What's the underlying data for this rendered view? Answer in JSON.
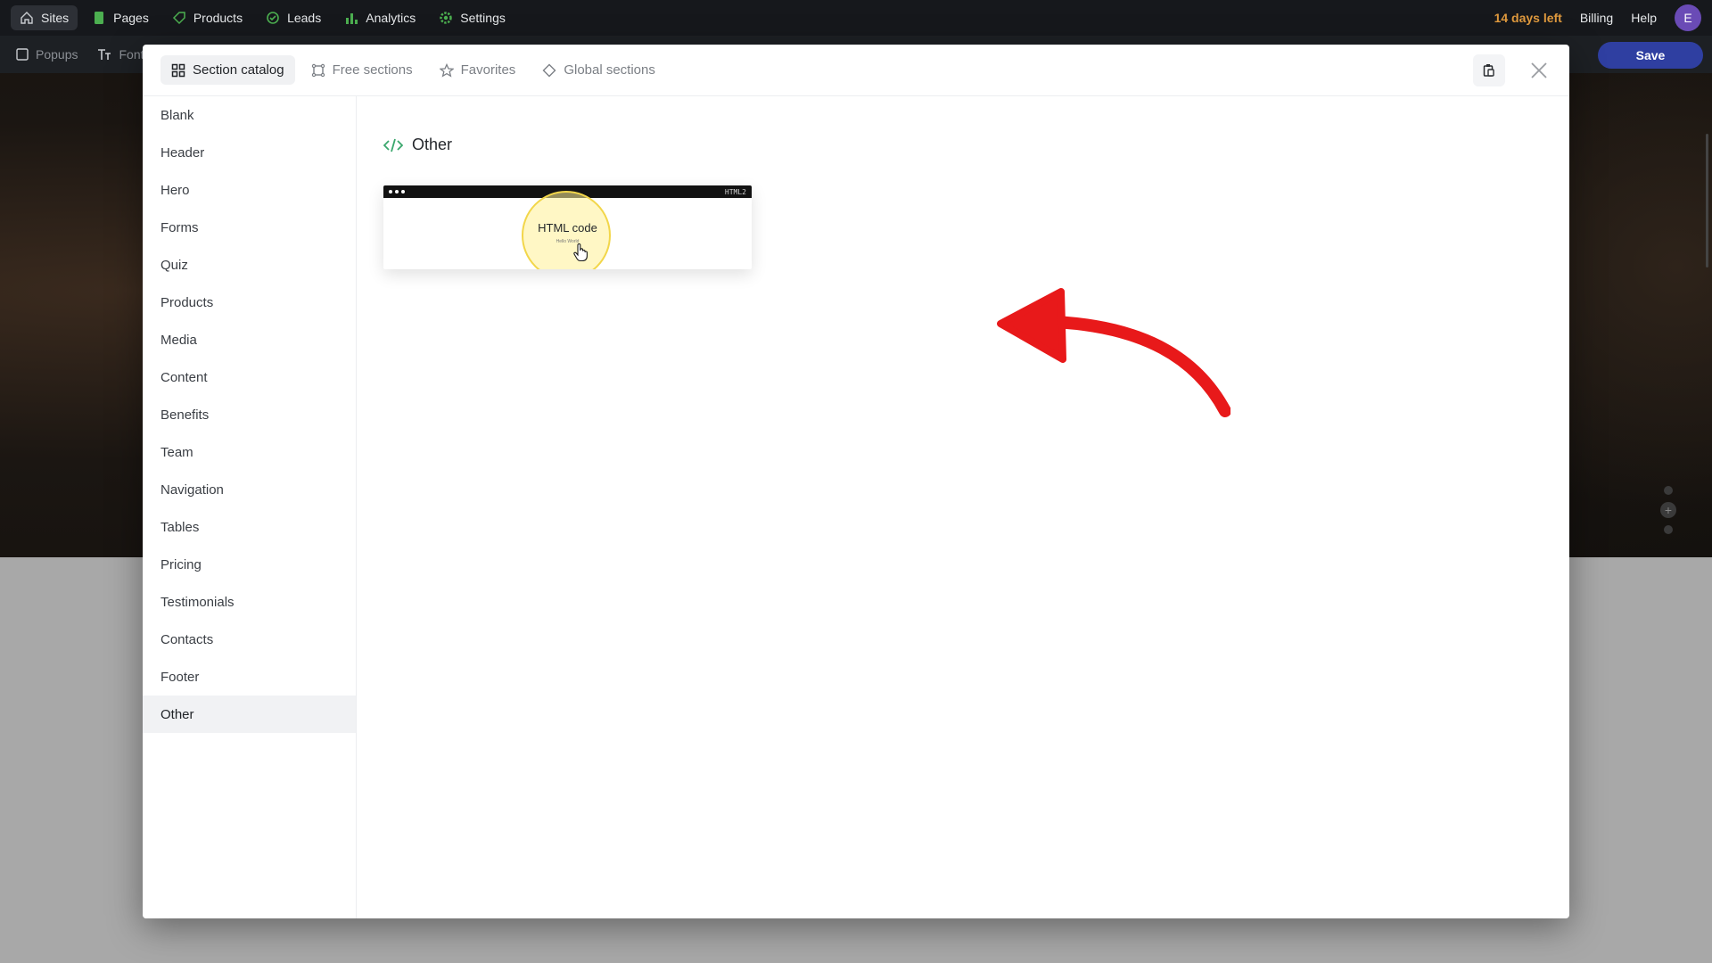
{
  "topbar": {
    "items": [
      {
        "label": "Sites",
        "icon": "home-icon"
      },
      {
        "label": "Pages",
        "icon": "pages-icon"
      },
      {
        "label": "Products",
        "icon": "tag-icon"
      },
      {
        "label": "Leads",
        "icon": "leads-icon"
      },
      {
        "label": "Analytics",
        "icon": "analytics-icon"
      },
      {
        "label": "Settings",
        "icon": "gear-icon"
      }
    ],
    "days_left": "14 days left",
    "billing": "Billing",
    "help": "Help",
    "avatar_initial": "E"
  },
  "toolbar2": {
    "popups": "Popups",
    "fonts": "Font"
  },
  "save_label": "Save",
  "modal": {
    "tabs": [
      {
        "label": "Section catalog",
        "icon": "grid-icon"
      },
      {
        "label": "Free sections",
        "icon": "frame-icon"
      },
      {
        "label": "Favorites",
        "icon": "star-icon"
      },
      {
        "label": "Global sections",
        "icon": "diamond-icon"
      }
    ],
    "categories": [
      "Blank",
      "Header",
      "Hero",
      "Forms",
      "Quiz",
      "Products",
      "Media",
      "Content",
      "Benefits",
      "Team",
      "Navigation",
      "Tables",
      "Pricing",
      "Testimonials",
      "Contacts",
      "Footer",
      "Other"
    ],
    "active_category": "Other",
    "content_title": "Other",
    "card": {
      "tag": "HTML2",
      "title": "HTML code",
      "subtitle": "Hello World"
    }
  },
  "colors": {
    "accent": "#2f3fa1",
    "days_left": "#e09a3e",
    "arrow": "#e8191a",
    "highlight": "#f2d64a",
    "code_icon": "#3aa76d"
  }
}
